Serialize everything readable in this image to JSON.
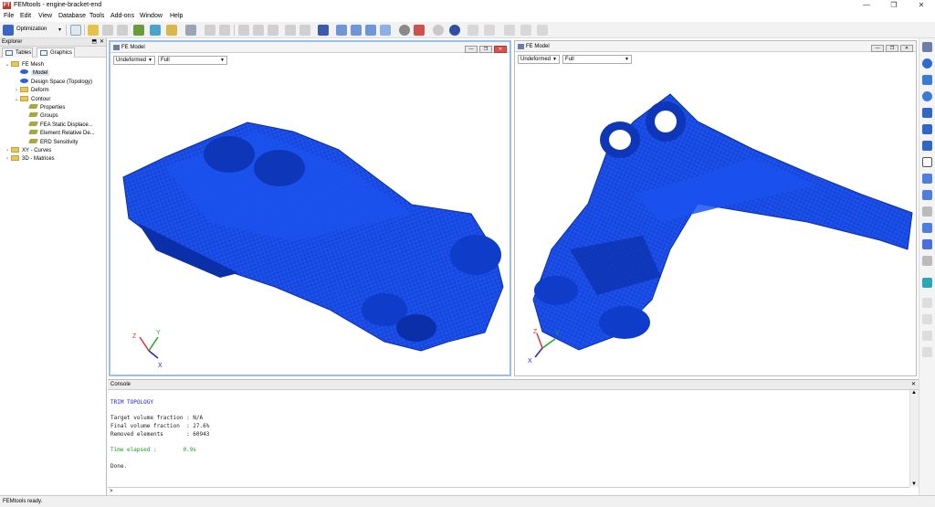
{
  "window": {
    "title": "FEMtools - engine-bracket-end",
    "app_icon": "FT",
    "min": "—",
    "max": "❐",
    "close": "✕"
  },
  "menu": [
    "File",
    "Edit",
    "View",
    "Database",
    "Tools",
    "Add-ons",
    "Window",
    "Help"
  ],
  "toolbar": {
    "optimization_label": "Optimization"
  },
  "explorer": {
    "title": "Explorer",
    "pin": "⬒",
    "close": "✕",
    "tabs": [
      "Tables",
      "Graphics"
    ],
    "tree": [
      {
        "label": "FE Mesh",
        "level": 0,
        "expander": "⌄",
        "kind": "folder"
      },
      {
        "label": "Model",
        "level": 1,
        "expander": "",
        "kind": "blue",
        "selected": true
      },
      {
        "label": "Design Space (Topology)",
        "level": 1,
        "expander": "",
        "kind": "blue"
      },
      {
        "label": "Deform",
        "level": 1,
        "expander": "›",
        "kind": "folder"
      },
      {
        "label": "Contour",
        "level": 1,
        "expander": "⌄",
        "kind": "folder"
      },
      {
        "label": "Properties",
        "level": 2,
        "expander": "",
        "kind": "olive"
      },
      {
        "label": "Groups",
        "level": 2,
        "expander": "",
        "kind": "olive"
      },
      {
        "label": "FEA Static Displace...",
        "level": 2,
        "expander": "",
        "kind": "olive"
      },
      {
        "label": "Element Relative De...",
        "level": 2,
        "expander": "",
        "kind": "olive"
      },
      {
        "label": "ERD Sensitivity",
        "level": 2,
        "expander": "",
        "kind": "olive"
      },
      {
        "label": "XY - Curves",
        "level": 0,
        "expander": "›",
        "kind": "folder"
      },
      {
        "label": "3D - Matrices",
        "level": 0,
        "expander": "›",
        "kind": "folder"
      }
    ]
  },
  "viewports": [
    {
      "title": "FE Model",
      "deform": "Undeformed",
      "display": "Full"
    },
    {
      "title": "FE Model",
      "deform": "Undeformed",
      "display": "Full"
    }
  ],
  "axes": {
    "z": "Z",
    "y": "Y",
    "x": "X"
  },
  "console": {
    "title": "Console",
    "close": "✕",
    "lines": [
      {
        "text": "TRIM TOPOLOGY",
        "color": "#1c1cd4"
      },
      {
        "text": "",
        "color": "#000"
      },
      {
        "text": "Target volume fraction : N/A",
        "color": "#222"
      },
      {
        "text": "Final volume fraction  : 27.6%",
        "color": "#222"
      },
      {
        "text": "Removed elements       : 60943",
        "color": "#222"
      },
      {
        "text": "",
        "color": "#000"
      },
      {
        "text": "Time elapsed :        0.9s",
        "color": "#1a9c1a"
      },
      {
        "text": "",
        "color": "#000"
      },
      {
        "text": "Done.",
        "color": "#222"
      }
    ],
    "prompt": ">",
    "scroll_up": "▲",
    "scroll_down": "▼"
  },
  "status": {
    "text": "FEMtools ready."
  },
  "colors": {
    "mesh": "#1446e0",
    "mesh_dark": "#0a2fa8",
    "accent": "#2a63d8"
  }
}
